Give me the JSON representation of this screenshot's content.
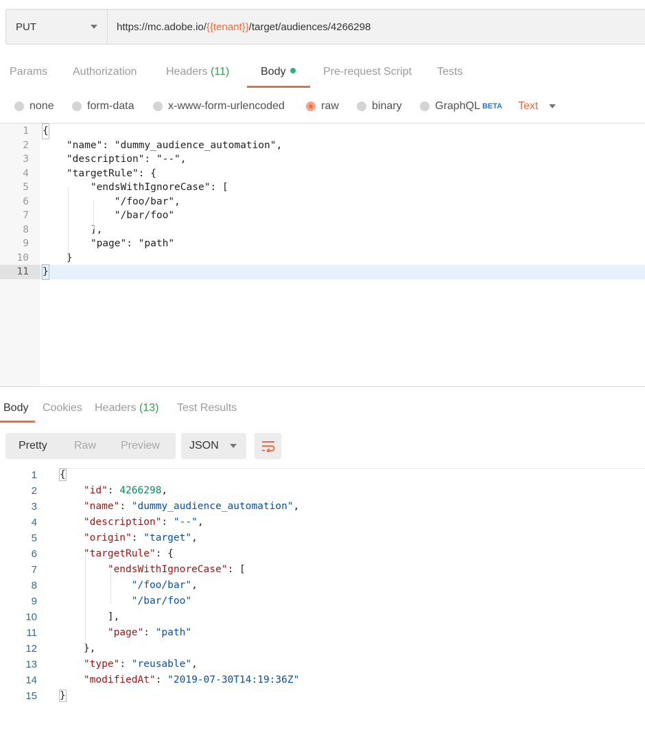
{
  "request": {
    "method": "PUT",
    "url_prefix": "https://mc.adobe.io/",
    "url_variable": "{{tenant}}",
    "url_suffix": "/target/audiences/4266298"
  },
  "request_tabs": {
    "params": "Params",
    "authorization": "Authorization",
    "headers": "Headers",
    "headers_count": "(11)",
    "body": "Body",
    "pre_request": "Pre-request Script",
    "tests": "Tests"
  },
  "body_types": {
    "none": "none",
    "form_data": "form-data",
    "urlencoded": "x-www-form-urlencoded",
    "raw": "raw",
    "binary": "binary",
    "graphql": "GraphQL",
    "graphql_badge": "BETA",
    "text_type": "Text"
  },
  "request_body": {
    "lines": [
      "{",
      "    \"name\": \"dummy_audience_automation\",",
      "    \"description\": \"--\",",
      "    \"targetRule\": {",
      "        \"endsWithIgnoreCase\": [",
      "            \"/foo/bar\",",
      "            \"/bar/foo\"",
      "        ],",
      "        \"page\": \"path\"",
      "    }",
      "}"
    ],
    "line_numbers": [
      "1",
      "2",
      "3",
      "4",
      "5",
      "6",
      "7",
      "8",
      "9",
      "10",
      "11"
    ]
  },
  "response_tabs": {
    "body": "Body",
    "cookies": "Cookies",
    "headers": "Headers",
    "headers_count": "(13)",
    "test_results": "Test Results"
  },
  "response_view": {
    "pretty": "Pretty",
    "raw": "Raw",
    "preview": "Preview",
    "format": "JSON"
  },
  "response_body": {
    "line_numbers": [
      "1",
      "2",
      "3",
      "4",
      "5",
      "6",
      "7",
      "8",
      "9",
      "10",
      "11",
      "12",
      "13",
      "14",
      "15"
    ],
    "lines": [
      [
        {
          "t": "p",
          "v": "{"
        }
      ],
      [
        {
          "t": "p",
          "v": "    "
        },
        {
          "t": "k",
          "v": "\"id\""
        },
        {
          "t": "p",
          "v": ": "
        },
        {
          "t": "n",
          "v": "4266298"
        },
        {
          "t": "p",
          "v": ","
        }
      ],
      [
        {
          "t": "p",
          "v": "    "
        },
        {
          "t": "k",
          "v": "\"name\""
        },
        {
          "t": "p",
          "v": ": "
        },
        {
          "t": "s",
          "v": "\"dummy_audience_automation\""
        },
        {
          "t": "p",
          "v": ","
        }
      ],
      [
        {
          "t": "p",
          "v": "    "
        },
        {
          "t": "k",
          "v": "\"description\""
        },
        {
          "t": "p",
          "v": ": "
        },
        {
          "t": "s",
          "v": "\"--\""
        },
        {
          "t": "p",
          "v": ","
        }
      ],
      [
        {
          "t": "p",
          "v": "    "
        },
        {
          "t": "k",
          "v": "\"origin\""
        },
        {
          "t": "p",
          "v": ": "
        },
        {
          "t": "s",
          "v": "\"target\""
        },
        {
          "t": "p",
          "v": ","
        }
      ],
      [
        {
          "t": "p",
          "v": "    "
        },
        {
          "t": "k",
          "v": "\"targetRule\""
        },
        {
          "t": "p",
          "v": ": {"
        }
      ],
      [
        {
          "t": "p",
          "v": "        "
        },
        {
          "t": "k",
          "v": "\"endsWithIgnoreCase\""
        },
        {
          "t": "p",
          "v": ": ["
        }
      ],
      [
        {
          "t": "p",
          "v": "            "
        },
        {
          "t": "s",
          "v": "\"/foo/bar\""
        },
        {
          "t": "p",
          "v": ","
        }
      ],
      [
        {
          "t": "p",
          "v": "            "
        },
        {
          "t": "s",
          "v": "\"/bar/foo\""
        }
      ],
      [
        {
          "t": "p",
          "v": "        ],"
        }
      ],
      [
        {
          "t": "p",
          "v": "        "
        },
        {
          "t": "k",
          "v": "\"page\""
        },
        {
          "t": "p",
          "v": ": "
        },
        {
          "t": "s",
          "v": "\"path\""
        }
      ],
      [
        {
          "t": "p",
          "v": "    },"
        }
      ],
      [
        {
          "t": "p",
          "v": "    "
        },
        {
          "t": "k",
          "v": "\"type\""
        },
        {
          "t": "p",
          "v": ": "
        },
        {
          "t": "s",
          "v": "\"reusable\""
        },
        {
          "t": "p",
          "v": ","
        }
      ],
      [
        {
          "t": "p",
          "v": "    "
        },
        {
          "t": "k",
          "v": "\"modifiedAt\""
        },
        {
          "t": "p",
          "v": ": "
        },
        {
          "t": "s",
          "v": "\"2019-07-30T14:19:36Z\""
        }
      ],
      [
        {
          "t": "p",
          "v": "}"
        }
      ]
    ]
  },
  "colors": {
    "accent": "#f26b3a",
    "count_green": "#3a9a54",
    "json_key": "#a31515",
    "json_string": "#0451a5",
    "json_number": "#09885a"
  }
}
